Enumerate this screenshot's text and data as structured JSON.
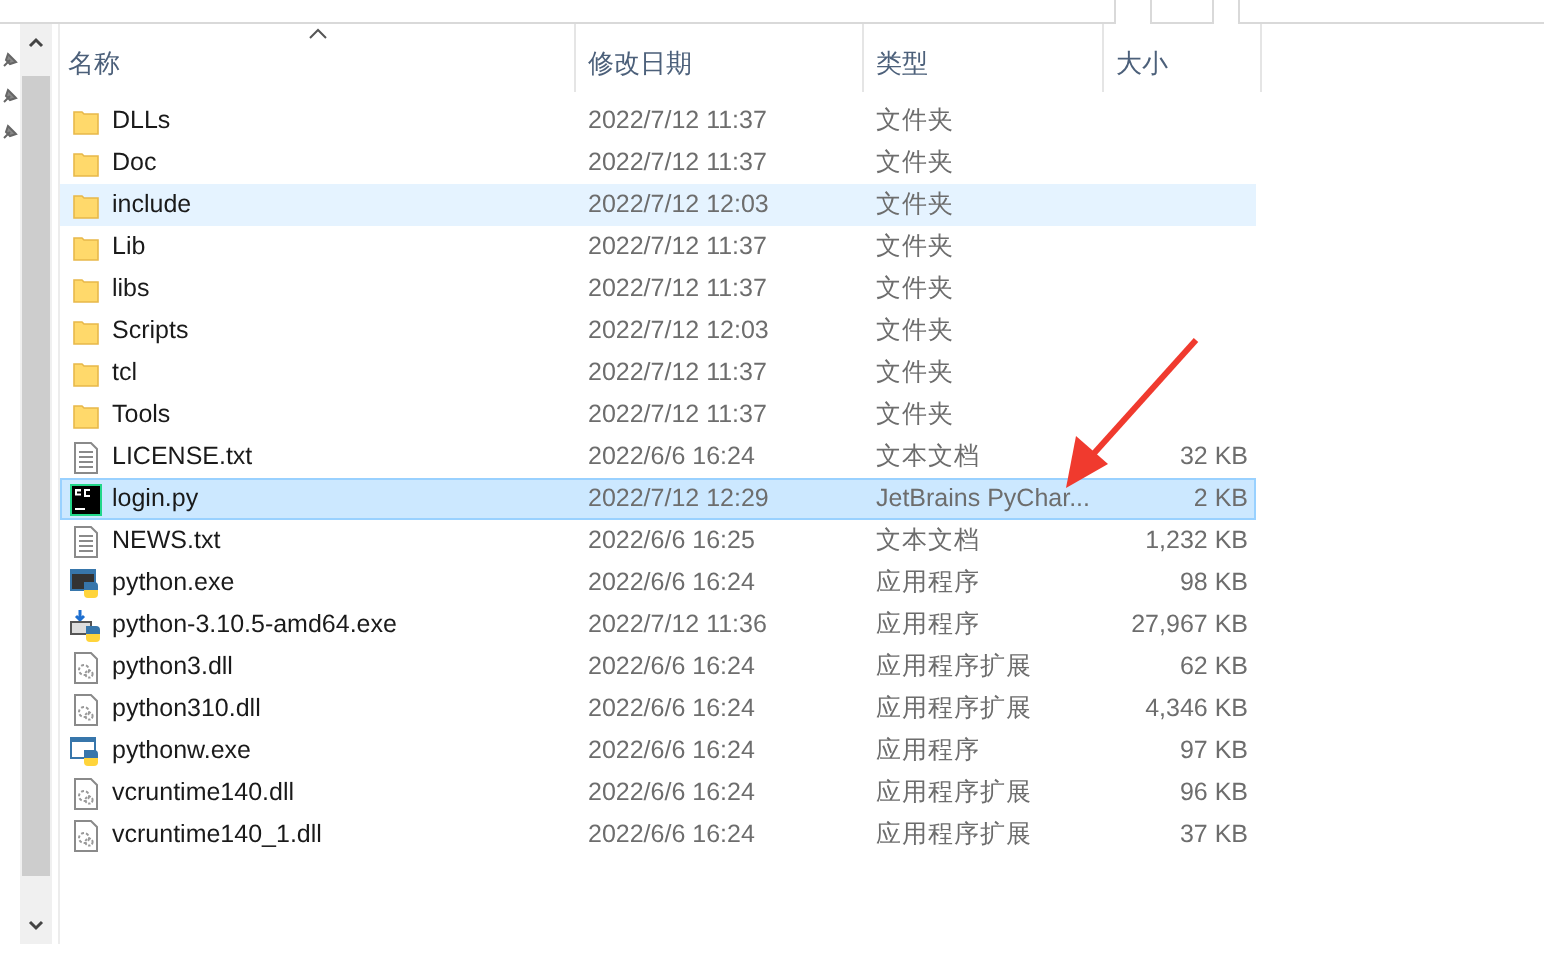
{
  "columns": [
    {
      "label": "名称",
      "sorted": true
    },
    {
      "label": "修改日期",
      "sorted": false
    },
    {
      "label": "类型",
      "sorted": false
    },
    {
      "label": "大小",
      "sorted": false
    }
  ],
  "rows": [
    {
      "kind": "folder",
      "name": "DLLs",
      "date": "2022/7/12 11:37",
      "type": "文件夹",
      "size": "",
      "hovered": false,
      "selected": false
    },
    {
      "kind": "folder",
      "name": "Doc",
      "date": "2022/7/12 11:37",
      "type": "文件夹",
      "size": "",
      "hovered": false,
      "selected": false
    },
    {
      "kind": "folder",
      "name": "include",
      "date": "2022/7/12 12:03",
      "type": "文件夹",
      "size": "",
      "hovered": true,
      "selected": false
    },
    {
      "kind": "folder",
      "name": "Lib",
      "date": "2022/7/12 11:37",
      "type": "文件夹",
      "size": "",
      "hovered": false,
      "selected": false
    },
    {
      "kind": "folder",
      "name": "libs",
      "date": "2022/7/12 11:37",
      "type": "文件夹",
      "size": "",
      "hovered": false,
      "selected": false
    },
    {
      "kind": "folder",
      "name": "Scripts",
      "date": "2022/7/12 12:03",
      "type": "文件夹",
      "size": "",
      "hovered": false,
      "selected": false
    },
    {
      "kind": "folder",
      "name": "tcl",
      "date": "2022/7/12 11:37",
      "type": "文件夹",
      "size": "",
      "hovered": false,
      "selected": false
    },
    {
      "kind": "folder",
      "name": "Tools",
      "date": "2022/7/12 11:37",
      "type": "文件夹",
      "size": "",
      "hovered": false,
      "selected": false
    },
    {
      "kind": "text",
      "name": "LICENSE.txt",
      "date": "2022/6/6 16:24",
      "type": "文本文档",
      "size": "32 KB",
      "hovered": false,
      "selected": false
    },
    {
      "kind": "pycharm",
      "name": "login.py",
      "date": "2022/7/12 12:29",
      "type": "JetBrains PyChar...",
      "size": "2 KB",
      "hovered": false,
      "selected": true
    },
    {
      "kind": "text",
      "name": "NEWS.txt",
      "date": "2022/6/6 16:25",
      "type": "文本文档",
      "size": "1,232 KB",
      "hovered": false,
      "selected": false
    },
    {
      "kind": "python",
      "name": "python.exe",
      "date": "2022/6/6 16:24",
      "type": "应用程序",
      "size": "98 KB",
      "hovered": false,
      "selected": false
    },
    {
      "kind": "installer",
      "name": "python-3.10.5-amd64.exe",
      "date": "2022/7/12 11:36",
      "type": "应用程序",
      "size": "27,967 KB",
      "hovered": false,
      "selected": false
    },
    {
      "kind": "dll",
      "name": "python3.dll",
      "date": "2022/6/6 16:24",
      "type": "应用程序扩展",
      "size": "62 KB",
      "hovered": false,
      "selected": false
    },
    {
      "kind": "dll",
      "name": "python310.dll",
      "date": "2022/6/6 16:24",
      "type": "应用程序扩展",
      "size": "4,346 KB",
      "hovered": false,
      "selected": false
    },
    {
      "kind": "pythonw",
      "name": "pythonw.exe",
      "date": "2022/6/6 16:24",
      "type": "应用程序",
      "size": "97 KB",
      "hovered": false,
      "selected": false
    },
    {
      "kind": "dll",
      "name": "vcruntime140.dll",
      "date": "2022/6/6 16:24",
      "type": "应用程序扩展",
      "size": "96 KB",
      "hovered": false,
      "selected": false
    },
    {
      "kind": "dll",
      "name": "vcruntime140_1.dll",
      "date": "2022/6/6 16:24",
      "type": "应用程序扩展",
      "size": "37 KB",
      "hovered": false,
      "selected": false
    }
  ]
}
